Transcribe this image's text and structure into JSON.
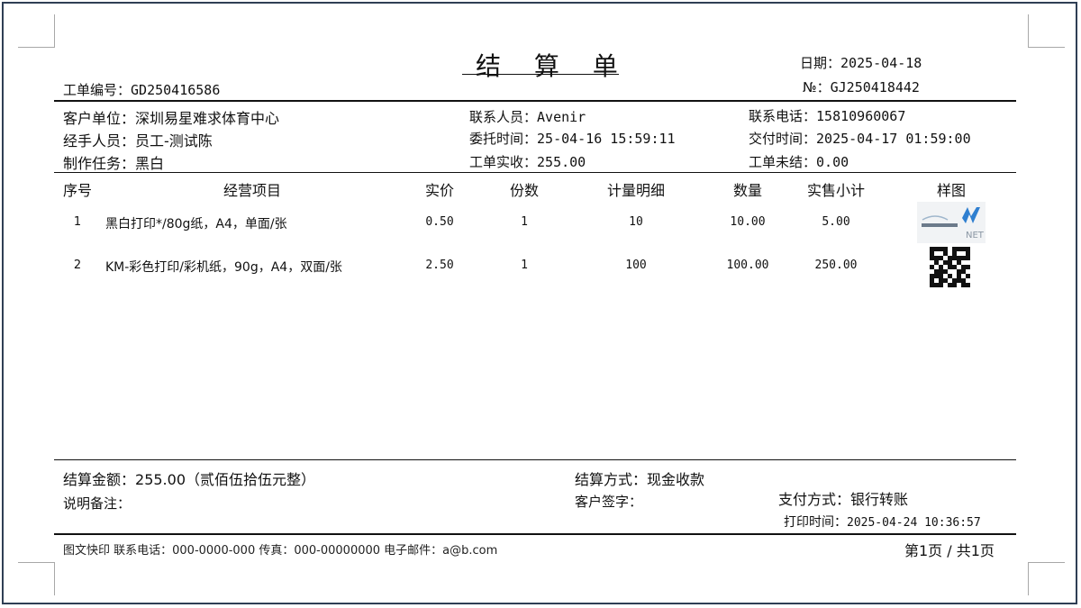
{
  "document": {
    "title": "结 算 单",
    "order_no_label": "工单编号：",
    "order_no": "GD250416586",
    "date_label": "日期：",
    "date": "2025-04-18",
    "serial_label": "№：",
    "serial": "GJ250418442"
  },
  "info": {
    "customer_label": "客户单位：",
    "customer": "深圳易星难求体育中心",
    "handler_label": "经手人员：",
    "handler": "员工-测试陈",
    "task_label": "制作任务：",
    "task": "黑白",
    "contact_label": "联系人员：",
    "contact": "Avenir",
    "commission_time_label": "委托时间：",
    "commission_time": "25-04-16 15:59:11",
    "order_paid_label": "工单实收：",
    "order_paid": "255.00",
    "phone_label": "联系电话：",
    "phone": "15810960067",
    "delivery_time_label": "交付时间：",
    "delivery_time": "2025-04-17 01:59:00",
    "order_unsettled_label": "工单未结：",
    "order_unsettled": "0.00"
  },
  "table": {
    "headers": [
      "序号",
      "经营项目",
      "实价",
      "份数",
      "计量明细",
      "数量",
      "实售小计",
      "样图"
    ],
    "rows": [
      {
        "no": "1",
        "item": "黑白打印*/80g纸，A4，单面/张",
        "price": "0.50",
        "copies": "1",
        "detail": "10",
        "qty": "10.00",
        "subtotal": "5.00",
        "sample": "logo-thumbnail"
      },
      {
        "no": "2",
        "item": "KM-彩色打印/彩机纸，90g，A4，双面/张",
        "price": "2.50",
        "copies": "1",
        "detail": "100",
        "qty": "100.00",
        "subtotal": "250.00",
        "sample": "qr-code-thumbnail"
      }
    ]
  },
  "summary": {
    "amount_label": "结算金额：",
    "amount": "255.00（贰佰伍拾伍元整）",
    "remark_label": "说明备注：",
    "remark": "",
    "settle_method_label": "结算方式：",
    "settle_method": "现金收款",
    "signature_label": "客户签字：",
    "payment_method_label": "支付方式：",
    "payment_method": "银行转账",
    "print_time_label": "打印时间：",
    "print_time": "2025-04-24 10:36:57"
  },
  "footer": {
    "contact_line": "图文快印 联系电话：000-0000-000 传真：000-00000000 电子邮件：a@b.com",
    "page_info": "第1页 / 共1页"
  },
  "logo_text": "NET"
}
